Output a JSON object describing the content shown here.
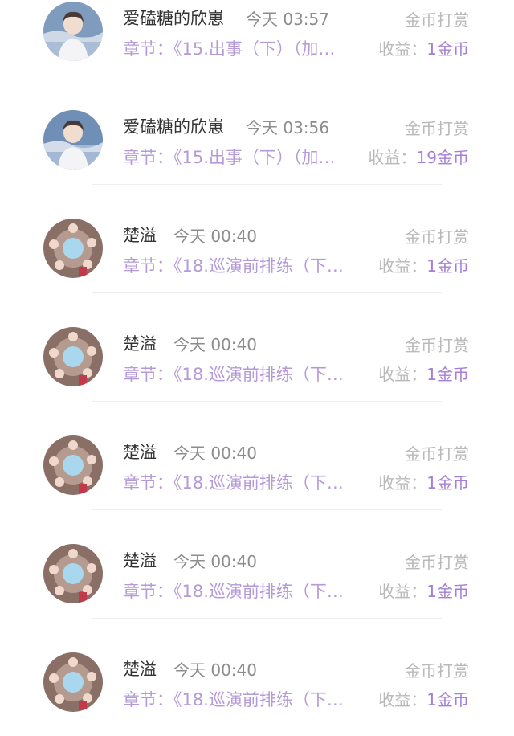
{
  "accent_color": "#a57fd6",
  "records": [
    {
      "name": "爱磕糖的欣崽",
      "time": "今天 03:57",
      "type": "金币打赏",
      "chapter": "章节：《15.出事（下）（加…",
      "income_label": "收益：",
      "income_value": "1金币",
      "avatar_icon": "user-avatar-boy-icon"
    },
    {
      "name": "爱磕糖的欣崽",
      "time": "今天 03:56",
      "type": "金币打赏",
      "chapter": "章节：《15.出事（下）（加…",
      "income_label": "收益：",
      "income_value": "19金币",
      "avatar_icon": "user-avatar-boy-icon"
    },
    {
      "name": "楚溢",
      "time": "今天 00:40",
      "type": "金币打赏",
      "chapter": "章节：《18.巡演前排练（下…",
      "income_label": "收益：",
      "income_value": "1金币",
      "avatar_icon": "user-avatar-group-icon"
    },
    {
      "name": "楚溢",
      "time": "今天 00:40",
      "type": "金币打赏",
      "chapter": "章节：《18.巡演前排练（下…",
      "income_label": "收益：",
      "income_value": "1金币",
      "avatar_icon": "user-avatar-group-icon"
    },
    {
      "name": "楚溢",
      "time": "今天 00:40",
      "type": "金币打赏",
      "chapter": "章节：《18.巡演前排练（下…",
      "income_label": "收益：",
      "income_value": "1金币",
      "avatar_icon": "user-avatar-group-icon"
    },
    {
      "name": "楚溢",
      "time": "今天 00:40",
      "type": "金币打赏",
      "chapter": "章节：《18.巡演前排练（下…",
      "income_label": "收益：",
      "income_value": "1金币",
      "avatar_icon": "user-avatar-group-icon"
    },
    {
      "name": "楚溢",
      "time": "今天 00:40",
      "type": "金币打赏",
      "chapter": "章节：《18.巡演前排练（下…",
      "income_label": "收益：",
      "income_value": "1金币",
      "avatar_icon": "user-avatar-group-icon"
    }
  ]
}
